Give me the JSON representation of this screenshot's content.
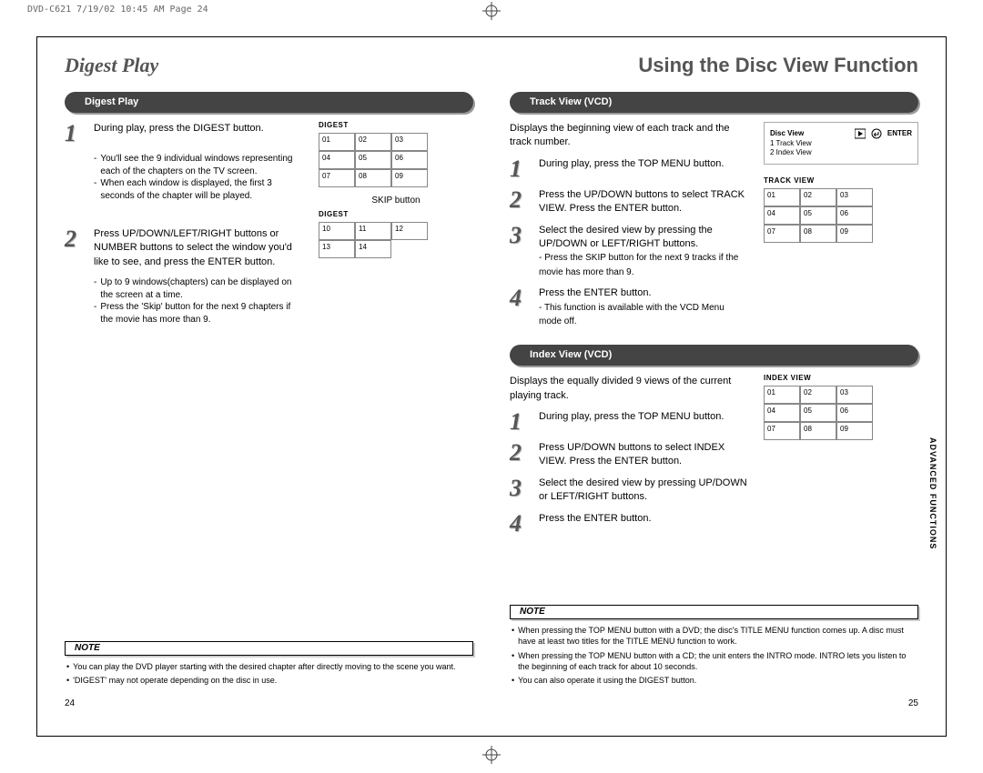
{
  "print_header": "DVD-C621  7/19/02 10:45 AM  Page 24",
  "left": {
    "title": "Digest Play",
    "pill": "Digest Play",
    "step1": "During play, press the DIGEST button.",
    "step1_sub1": "You'll see the 9 individual windows representing each of the chapters on the TV screen.",
    "step1_sub2": "When each window is displayed, the first 3 seconds of the chapter will be played.",
    "grid1_label": "DIGEST",
    "grid1_cells": [
      "01",
      "02",
      "03",
      "04",
      "05",
      "06",
      "07",
      "08",
      "09"
    ],
    "skip_label": "SKIP button",
    "step2": "Press UP/DOWN/LEFT/RIGHT buttons or NUMBER buttons to select the window you'd like to see, and press the ENTER button.",
    "step2_sub1": "Up to 9 windows(chapters) can be displayed on the screen at a time.",
    "step2_sub2": "Press the 'Skip' button for the next 9 chapters if the movie has more than 9.",
    "grid2_label": "DIGEST",
    "grid2_cells": [
      "10",
      "11",
      "12",
      "13",
      "14"
    ],
    "note_label": "NOTE",
    "note1": "You can play the DVD player starting with the desired chapter after directly moving to the scene you want.",
    "note2": "'DIGEST' may not operate depending on the disc in use.",
    "page_number": "24"
  },
  "right": {
    "title": "Using the Disc View Function",
    "sectionA_pill": "Track View (VCD)",
    "sectionA_intro": "Displays the beginning view of each track and the track number.",
    "osd_title": "Disc View",
    "osd_enter": "ENTER",
    "osd_line1": "1  Track  View",
    "osd_line2": "2  Index  View",
    "a_step1": "During play, press the TOP MENU button.",
    "a_step2": "Press the UP/DOWN buttons to select TRACK VIEW. Press the ENTER button.",
    "a_step3a": "Select the desired view by pressing the UP/DOWN or LEFT/RIGHT buttons.",
    "a_step3b": "Press the SKIP button for the next 9 tracks if the movie has more than 9.",
    "a_step4a": "Press the ENTER button.",
    "a_step4b": "This function is available with the VCD Menu mode off.",
    "gridA_label": "TRACK VIEW",
    "gridA_cells": [
      "01",
      "02",
      "03",
      "04",
      "05",
      "06",
      "07",
      "08",
      "09"
    ],
    "sectionB_pill": "Index View (VCD)",
    "sectionB_intro": "Displays the equally divided 9 views of the current playing track.",
    "b_step1": "During play, press the TOP MENU button.",
    "b_step2": "Press UP/DOWN buttons to select INDEX VIEW. Press the ENTER button.",
    "b_step3": "Select the desired view by pressing UP/DOWN or LEFT/RIGHT buttons.",
    "b_step4": "Press the ENTER button.",
    "gridB_label": "INDEX VIEW",
    "gridB_cells": [
      "01",
      "02",
      "03",
      "04",
      "05",
      "06",
      "07",
      "08",
      "09"
    ],
    "note_label": "NOTE",
    "noteA": "When pressing the TOP MENU button with a DVD; the disc's TITLE MENU function comes up. A disc must have at least two titles for the TITLE MENU function to work.",
    "noteB": "When pressing the TOP MENU button with a CD; the unit enters the INTRO mode. INTRO lets you listen to the beginning of each track for about 10 seconds.",
    "noteC": "You can also operate it using the DIGEST button.",
    "spine": "ADVANCED FUNCTIONS",
    "page_number": "25"
  }
}
